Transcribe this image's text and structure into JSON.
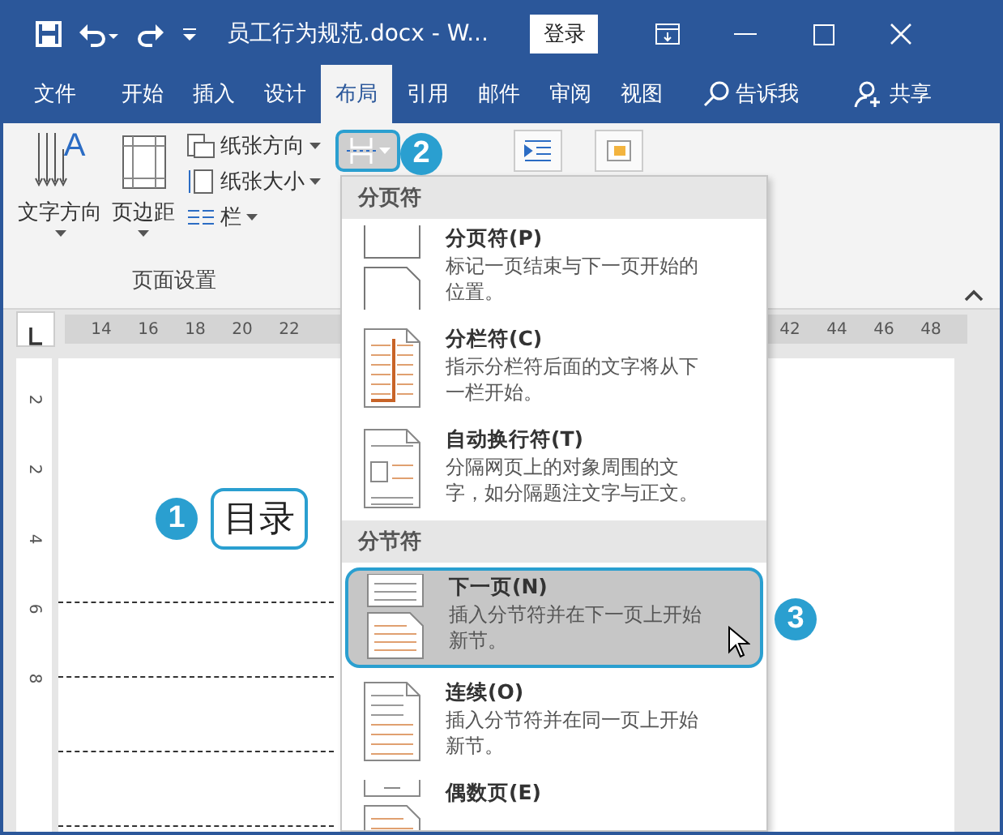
{
  "title_bar": {
    "title": "员工行为规范.docx  -  W...",
    "login_button": "登录"
  },
  "tabs": [
    {
      "label": "文件",
      "selected": false
    },
    {
      "label": "开始",
      "selected": false
    },
    {
      "label": "插入",
      "selected": false
    },
    {
      "label": "设计",
      "selected": false
    },
    {
      "label": "布局",
      "selected": true
    },
    {
      "label": "引用",
      "selected": false
    },
    {
      "label": "邮件",
      "selected": false
    },
    {
      "label": "审阅",
      "selected": false
    },
    {
      "label": "视图",
      "selected": false
    }
  ],
  "tell_me": "告诉我",
  "share": "共享",
  "ribbon": {
    "large_commands": [
      {
        "label": "文字方向",
        "kind": "text_direction",
        "icon_text": "A"
      },
      {
        "label": "页边距",
        "kind": "margins"
      }
    ],
    "small_commands": [
      {
        "label": "纸张方向",
        "kind": "orientation"
      },
      {
        "label": "纸张大小",
        "kind": "size"
      },
      {
        "label": "栏",
        "kind": "columns"
      }
    ],
    "group_label": "页面设置"
  },
  "ruler": {
    "left_numbers": [
      "14",
      "16",
      "18",
      "20",
      "22"
    ],
    "right_numbers": [
      "42",
      "44",
      "46",
      "48"
    ]
  },
  "vertical_ruler": [
    "2",
    "2",
    "4",
    "6",
    "8"
  ],
  "document": {
    "heading": "目录"
  },
  "callouts": [
    "1",
    "2",
    "3"
  ],
  "breaks_menu": {
    "sections": [
      {
        "header": "分页符",
        "items": [
          {
            "kind": "page",
            "title": "分页符(P)",
            "description": "标记一页结束与下一页开始的位置。",
            "selected": false
          },
          {
            "kind": "column",
            "title": "分栏符(C)",
            "description": "指示分栏符后面的文字将从下一栏开始。",
            "selected": false
          },
          {
            "kind": "wrap",
            "title": "自动换行符(T)",
            "description": "分隔网页上的对象周围的文字，如分隔题注文字与正文。",
            "selected": false
          }
        ]
      },
      {
        "header": "分节符",
        "items": [
          {
            "kind": "next",
            "title": "下一页(N)",
            "description": "插入分节符并在下一页上开始新节。",
            "selected": true
          },
          {
            "kind": "continuous",
            "title": "连续(O)",
            "description": "插入分节符并在同一页上开始新节。",
            "selected": false
          },
          {
            "kind": "even",
            "title": "偶数页(E)",
            "selected": false
          }
        ]
      }
    ]
  }
}
